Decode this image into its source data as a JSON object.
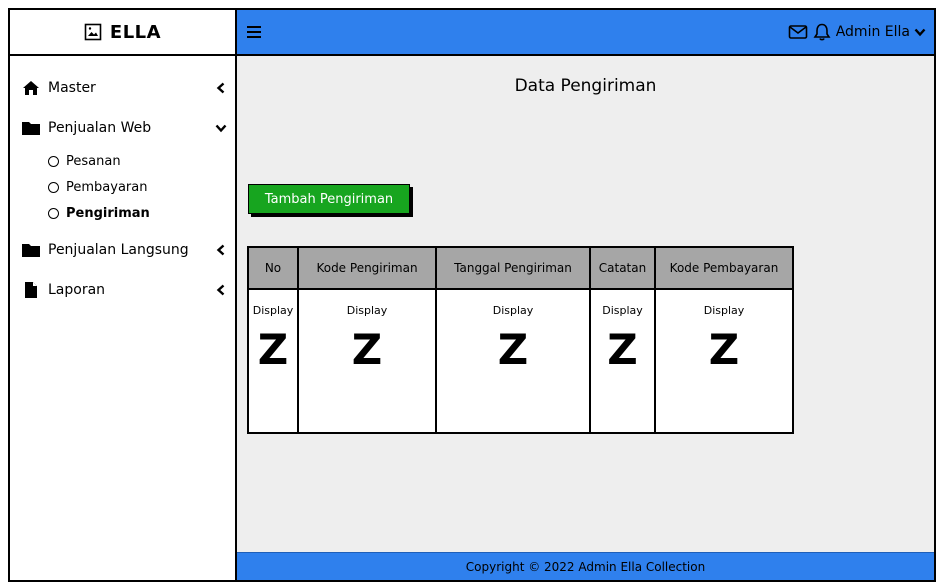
{
  "brand": {
    "name": "ELLA",
    "icon": "image-file-icon"
  },
  "sidebar": {
    "items": [
      {
        "label": "Master",
        "icon": "home-icon",
        "chevron": "chevron-left-icon"
      },
      {
        "label": "Penjualan Web",
        "icon": "folder-icon",
        "chevron": "chevron-down-icon",
        "children": [
          {
            "label": "Pesanan",
            "active": false
          },
          {
            "label": "Pembayaran",
            "active": false
          },
          {
            "label": "Pengiriman",
            "active": true
          }
        ]
      },
      {
        "label": "Penjualan Langsung",
        "icon": "folder-icon",
        "chevron": "chevron-left-icon"
      },
      {
        "label": "Laporan",
        "icon": "file-icon",
        "chevron": "chevron-left-icon"
      }
    ]
  },
  "topbar": {
    "user_label": "Admin Ella",
    "icons": [
      "menu-icon",
      "mail-icon",
      "bell-icon",
      "chevron-down-icon"
    ]
  },
  "main": {
    "title": "Data Pengiriman",
    "add_button": "Tambah Pengiriman",
    "table": {
      "headers": [
        "No",
        "Kode Pengiriman",
        "Tanggal Pengiriman",
        "Catatan",
        "Kode Pembayaran"
      ],
      "rows": [
        [
          "Display",
          "Display",
          "Display",
          "Display",
          "Display"
        ]
      ],
      "placeholder_glyph": "Z"
    }
  },
  "footer": {
    "text": "Copyright © 2022 Admin Ella Collection"
  },
  "colors": {
    "primary": "#2f80ed",
    "success": "#17a51f",
    "content_bg": "#eeeeee",
    "table_header": "#a6a6a6"
  }
}
